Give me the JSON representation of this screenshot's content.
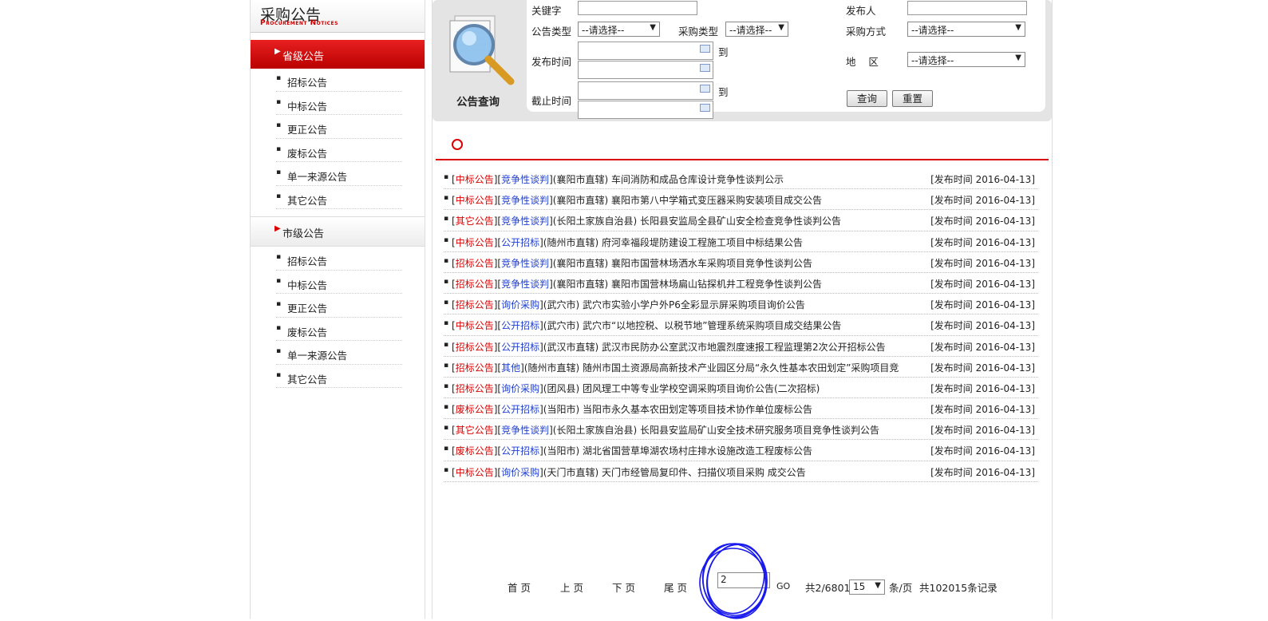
{
  "sidebar": {
    "title": "采购公告",
    "subtitle": "Procurement Notices",
    "sections": [
      {
        "label": "省级公告",
        "items": [
          "招标公告",
          "中标公告",
          "更正公告",
          "废标公告",
          "单一来源公告",
          "其它公告"
        ]
      },
      {
        "label": "市级公告",
        "items": [
          "招标公告",
          "中标公告",
          "更正公告",
          "废标公告",
          "单一来源公告",
          "其它公告"
        ]
      }
    ]
  },
  "search": {
    "heading": "公告查询",
    "keyword_label": "关键字",
    "publisher_label": "发布人",
    "notice_type_label": "公告类型",
    "notice_type_value": "--请选择--",
    "purchase_type_label": "采购类型",
    "purchase_type_value": "--请选择--",
    "purchase_method_label": "采购方式",
    "purchase_method_value": "--请选择--",
    "publish_time_label": "发布时间",
    "to_label": "到",
    "region_label": "地    区",
    "region_value": "--请选择--",
    "deadline_label": "截止时间",
    "query_button": "查询",
    "reset_button": "重置"
  },
  "notices": [
    {
      "type": "中标公告",
      "method": "竞争性谈判",
      "region": "(襄阳市直辖)",
      "title": "车间消防和成品仓库设计竞争性谈判公示",
      "date": "[发布时间 2016-04-13]"
    },
    {
      "type": "中标公告",
      "method": "竞争性谈判",
      "region": "(襄阳市直辖)",
      "title": "襄阳市第八中学箱式变压器采购安装项目成交公告",
      "date": "[发布时间 2016-04-13]"
    },
    {
      "type": "其它公告",
      "method": "竞争性谈判",
      "region": "(长阳土家族自治县)",
      "title": "长阳县安监局全县矿山安全检查竞争性谈判公告",
      "date": "[发布时间 2016-04-13]"
    },
    {
      "type": "中标公告",
      "method": "公开招标",
      "region": "(随州市直辖)",
      "title": "府河幸福段堤防建设工程施工项目中标结果公告",
      "date": "[发布时间 2016-04-13]"
    },
    {
      "type": "招标公告",
      "method": "竞争性谈判",
      "region": "(襄阳市直辖)",
      "title": "襄阳市国营林场洒水车采购项目竞争性谈判公告",
      "date": "[发布时间 2016-04-13]"
    },
    {
      "type": "招标公告",
      "method": "竞争性谈判",
      "region": "(襄阳市直辖)",
      "title": "襄阳市国营林场扁山钻探机井工程竞争性谈判公告",
      "date": "[发布时间 2016-04-13]"
    },
    {
      "type": "招标公告",
      "method": "询价采购",
      "region": "(武穴市)",
      "title": "武穴市实验小学户外P6全彩显示屏采购项目询价公告",
      "date": "[发布时间 2016-04-13]"
    },
    {
      "type": "中标公告",
      "method": "公开招标",
      "region": "(武穴市)",
      "title": "武穴市“以地控税、以税节地”管理系统采购项目成交结果公告",
      "date": "[发布时间 2016-04-13]"
    },
    {
      "type": "招标公告",
      "method": "公开招标",
      "region": "(武汉市直辖)",
      "title": "武汉市民防办公室武汉市地震烈度速报工程监理第2次公开招标公告",
      "date": "[发布时间 2016-04-13]"
    },
    {
      "type": "招标公告",
      "method": "其他",
      "region": "(随州市直辖)",
      "title": "随州市国土资源局高新技术产业园区分局“永久性基本农田划定”采购项目竞",
      "date": "[发布时间 2016-04-13]"
    },
    {
      "type": "招标公告",
      "method": "询价采购",
      "region": "(团风县)",
      "title": "团风理工中等专业学校空调采购项目询价公告(二次招标)",
      "date": "[发布时间 2016-04-13]"
    },
    {
      "type": "废标公告",
      "method": "公开招标",
      "region": "(当阳市)",
      "title": "当阳市永久基本农田划定等项目技术协作单位废标公告",
      "date": "[发布时间 2016-04-13]"
    },
    {
      "type": "其它公告",
      "method": "竞争性谈判",
      "region": "(长阳土家族自治县)",
      "title": "长阳县安监局矿山安全技术研究服务项目竞争性谈判公告",
      "date": "[发布时间 2016-04-13]"
    },
    {
      "type": "废标公告",
      "method": "公开招标",
      "region": "(当阳市)",
      "title": "湖北省国营草埠湖农场村庄排水设施改造工程废标公告",
      "date": "[发布时间 2016-04-13]"
    },
    {
      "type": "中标公告",
      "method": "询价采购",
      "region": "(天门市直辖)",
      "title": "天门市经管局复印件、扫描仪项目采购 成交公告",
      "date": "[发布时间 2016-04-13]"
    }
  ],
  "pager": {
    "first": "首 页",
    "prev": "上 页",
    "next": "下 页",
    "last": "尾 页",
    "page_input": "2",
    "go": "GO",
    "page_info": "共2/6801",
    "per_page": "15",
    "per_page_suffix": "条/页",
    "total": "共102015条记录"
  },
  "colors": {
    "accent": "#d00000",
    "link_blue": "#1f3fd0",
    "scribble": "#1a1aee"
  }
}
